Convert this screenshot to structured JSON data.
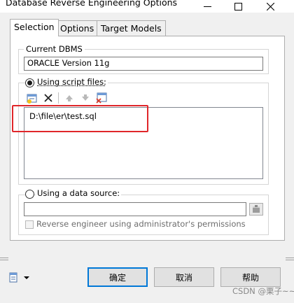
{
  "window": {
    "title": "Database Reverse Engineering Options"
  },
  "tabs": [
    {
      "label": "Selection",
      "active": true
    },
    {
      "label": "Options",
      "active": false
    },
    {
      "label": "Target Models",
      "active": false
    }
  ],
  "dbms": {
    "group_label": "Current DBMS",
    "value": "ORACLE Version 11g"
  },
  "script_files": {
    "radio_label": "Using script files:",
    "selected": true,
    "toolbar_icons": [
      "add-file-icon",
      "delete-icon",
      "move-up-icon",
      "move-down-icon",
      "clear-list-icon"
    ],
    "files": [
      "D:\\file\\er\\test.sql"
    ]
  },
  "data_source": {
    "radio_label": "Using a data source:",
    "selected": false,
    "value": "",
    "admin_checkbox_label": "Reverse engineer using administrator's permissions",
    "admin_checked": false
  },
  "buttons": {
    "ok": "确定",
    "cancel": "取消",
    "help": "帮助"
  },
  "watermark": "CSDN @栗子~~",
  "colors": {
    "highlight": "#e0262a",
    "default_button_border": "#0078d7"
  }
}
